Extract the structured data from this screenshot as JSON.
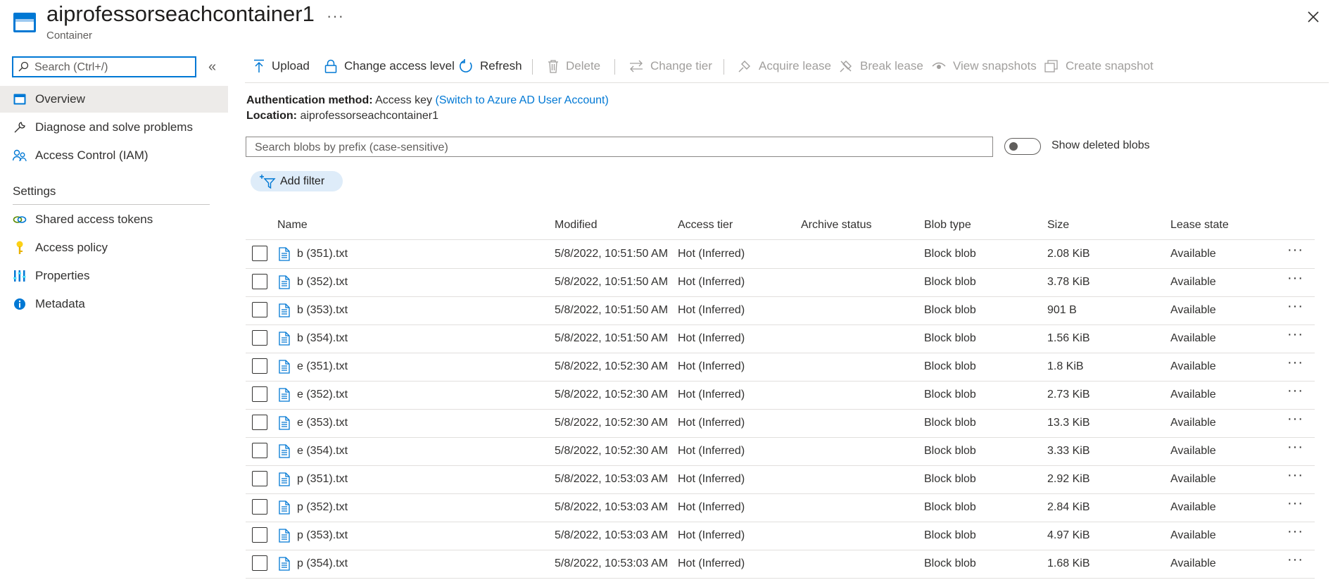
{
  "header": {
    "title": "aiprofessorseachcontainer1",
    "subtitle": "Container",
    "more": "···"
  },
  "sidebar": {
    "search_placeholder": "Search (Ctrl+/)",
    "collapse": "«",
    "items": [
      {
        "label": "Overview",
        "icon": "container-icon",
        "active": true
      },
      {
        "label": "Diagnose and solve problems",
        "icon": "wrench-icon"
      },
      {
        "label": "Access Control (IAM)",
        "icon": "people-icon"
      }
    ],
    "settings_header": "Settings",
    "settings_items": [
      {
        "label": "Shared access tokens",
        "icon": "link-icon"
      },
      {
        "label": "Access policy",
        "icon": "key-icon"
      },
      {
        "label": "Properties",
        "icon": "properties-icon"
      },
      {
        "label": "Metadata",
        "icon": "info-icon"
      }
    ]
  },
  "toolbar": {
    "upload": "Upload",
    "change_access_level": "Change access level",
    "refresh": "Refresh",
    "delete": "Delete",
    "change_tier": "Change tier",
    "acquire_lease": "Acquire lease",
    "break_lease": "Break lease",
    "view_snapshots": "View snapshots",
    "create_snapshot": "Create snapshot"
  },
  "info": {
    "auth_label": "Authentication method:",
    "auth_value": "Access key",
    "auth_link": "(Switch to Azure AD User Account)",
    "location_label": "Location:",
    "location_value": "aiprofessorseachcontainer1"
  },
  "blob_search": {
    "placeholder": "Search blobs by prefix (case-sensitive)"
  },
  "show_deleted_label": "Show deleted blobs",
  "add_filter_label": "Add filter",
  "table": {
    "columns": [
      "Name",
      "Modified",
      "Access tier",
      "Archive status",
      "Blob type",
      "Size",
      "Lease state"
    ],
    "rows": [
      {
        "name": "b (351).txt",
        "modified": "5/8/2022, 10:51:50 AM",
        "tier": "Hot (Inferred)",
        "archive": "",
        "type": "Block blob",
        "size": "2.08 KiB",
        "lease": "Available"
      },
      {
        "name": "b (352).txt",
        "modified": "5/8/2022, 10:51:50 AM",
        "tier": "Hot (Inferred)",
        "archive": "",
        "type": "Block blob",
        "size": "3.78 KiB",
        "lease": "Available"
      },
      {
        "name": "b (353).txt",
        "modified": "5/8/2022, 10:51:50 AM",
        "tier": "Hot (Inferred)",
        "archive": "",
        "type": "Block blob",
        "size": "901 B",
        "lease": "Available"
      },
      {
        "name": "b (354).txt",
        "modified": "5/8/2022, 10:51:50 AM",
        "tier": "Hot (Inferred)",
        "archive": "",
        "type": "Block blob",
        "size": "1.56 KiB",
        "lease": "Available"
      },
      {
        "name": "e (351).txt",
        "modified": "5/8/2022, 10:52:30 AM",
        "tier": "Hot (Inferred)",
        "archive": "",
        "type": "Block blob",
        "size": "1.8 KiB",
        "lease": "Available"
      },
      {
        "name": "e (352).txt",
        "modified": "5/8/2022, 10:52:30 AM",
        "tier": "Hot (Inferred)",
        "archive": "",
        "type": "Block blob",
        "size": "2.73 KiB",
        "lease": "Available"
      },
      {
        "name": "e (353).txt",
        "modified": "5/8/2022, 10:52:30 AM",
        "tier": "Hot (Inferred)",
        "archive": "",
        "type": "Block blob",
        "size": "13.3 KiB",
        "lease": "Available"
      },
      {
        "name": "e (354).txt",
        "modified": "5/8/2022, 10:52:30 AM",
        "tier": "Hot (Inferred)",
        "archive": "",
        "type": "Block blob",
        "size": "3.33 KiB",
        "lease": "Available"
      },
      {
        "name": "p (351).txt",
        "modified": "5/8/2022, 10:53:03 AM",
        "tier": "Hot (Inferred)",
        "archive": "",
        "type": "Block blob",
        "size": "2.92 KiB",
        "lease": "Available"
      },
      {
        "name": "p (352).txt",
        "modified": "5/8/2022, 10:53:03 AM",
        "tier": "Hot (Inferred)",
        "archive": "",
        "type": "Block blob",
        "size": "2.84 KiB",
        "lease": "Available"
      },
      {
        "name": "p (353).txt",
        "modified": "5/8/2022, 10:53:03 AM",
        "tier": "Hot (Inferred)",
        "archive": "",
        "type": "Block blob",
        "size": "4.97 KiB",
        "lease": "Available"
      },
      {
        "name": "p (354).txt",
        "modified": "5/8/2022, 10:53:03 AM",
        "tier": "Hot (Inferred)",
        "archive": "",
        "type": "Block blob",
        "size": "1.68 KiB",
        "lease": "Available"
      }
    ],
    "row_more": "···"
  },
  "colors": {
    "accent": "#0078d4",
    "active_nav": "#edebe9",
    "disabled": "#a19f9d",
    "filter_pill": "#deecf9"
  }
}
